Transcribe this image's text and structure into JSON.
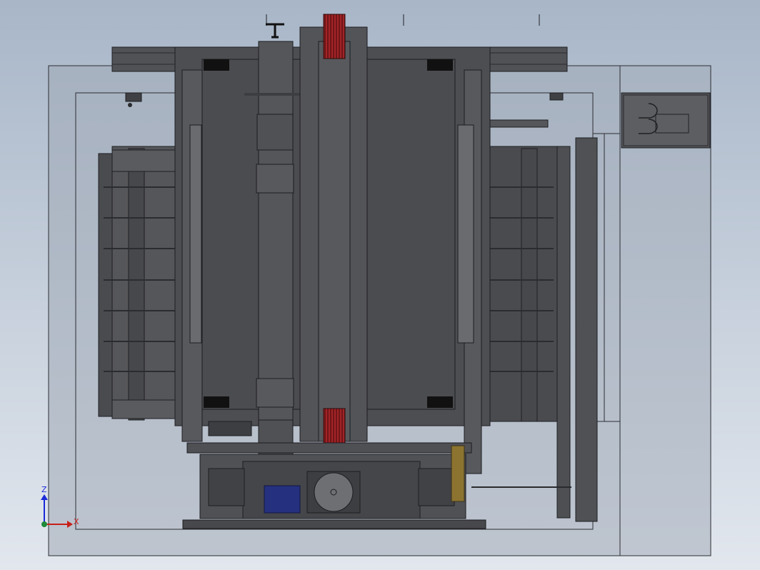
{
  "viewport": {
    "name": "cad-model-front-view",
    "background_top": "#a8b6c8",
    "background_bottom": "#dfe5ec"
  },
  "colors": {
    "housing_fill": "#9ea9b6",
    "housing_stroke": "#303236",
    "frame_dark": "#4a4b4e",
    "frame_mid": "#5a5b5f",
    "panel_light": "#6c6d71",
    "drum": "#4c4d50",
    "belt_red": "#8a1d1f",
    "motor_plate_blue": "#25307e",
    "brass_detail": "#8c7430"
  },
  "triad": {
    "z_label": "Z",
    "x_label": "X",
    "z_color": "#1a2ad8",
    "x_color": "#c8201a",
    "origin_color": "#1e8a3a",
    "icon": "coordinate-triad-icon"
  }
}
